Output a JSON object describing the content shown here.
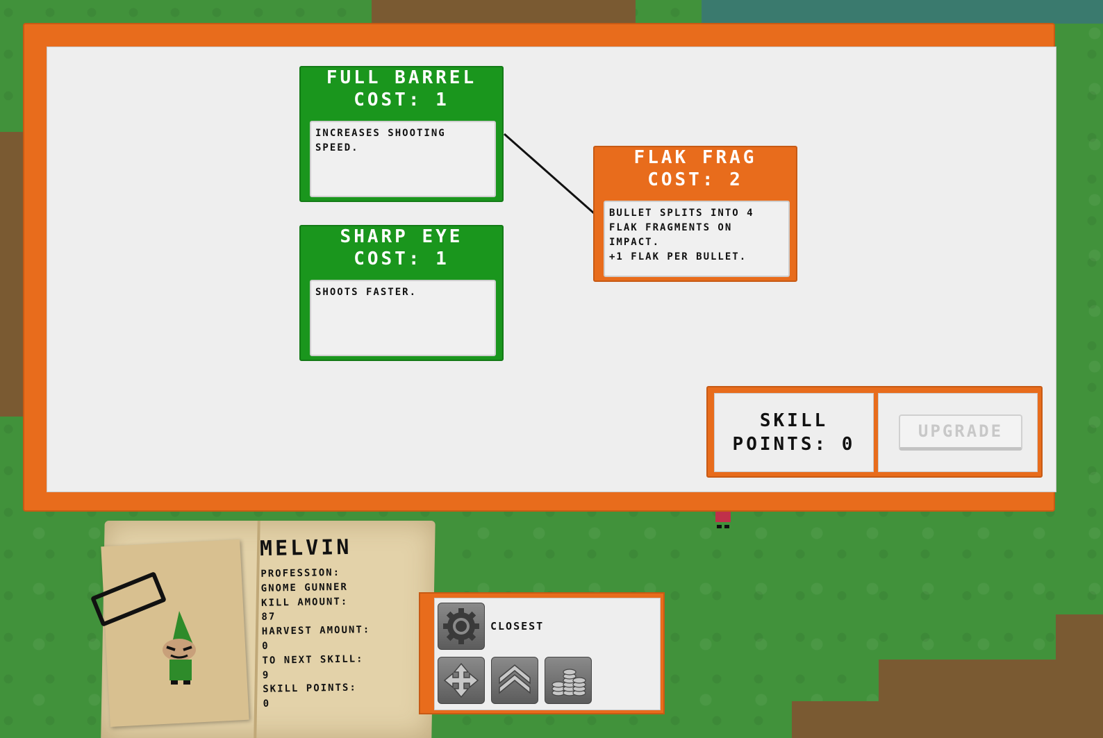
{
  "skill_tree": {
    "nodes": [
      {
        "title": "FULL BARREL",
        "cost": "COST: 1",
        "description": "INCREASES SHOOTING\nSPEED.",
        "state": "purchased",
        "color": "#1a961d"
      },
      {
        "title": "SHARP EYE",
        "cost": "COST: 1",
        "description": "SHOOTS FASTER.",
        "state": "purchased",
        "color": "#1a961d"
      },
      {
        "title": "FLAK FRAG",
        "cost": "COST: 2",
        "description": "BULLET SPLITS INTO 4\nFLAK FRAGMENTS ON\nIMPACT.\n+1 FLAK PER BULLET.",
        "state": "available",
        "color": "#e86c1c"
      }
    ],
    "skill_points_label": "SKILL POINTS: 0",
    "upgrade_label": "UPGRADE",
    "upgrade_enabled": false
  },
  "character": {
    "name": "MELVIN",
    "stats": [
      {
        "label": "PROFESSION:",
        "value": "GNOME GUNNER"
      },
      {
        "label": "KILL AMOUNT:",
        "value": "87"
      },
      {
        "label": "HARVEST AMOUNT:",
        "value": "0"
      },
      {
        "label": "TO NEXT SKILL:",
        "value": "9"
      },
      {
        "label": "SKILL POINTS:",
        "value": "0"
      }
    ]
  },
  "control_panel": {
    "targeting_label": "CLOSEST",
    "icons": [
      "gear-icon",
      "move-icon",
      "upgrade-chevron-icon",
      "coins-icon"
    ]
  },
  "colors": {
    "panel_orange": "#e86c1c",
    "purchased_green": "#1a961d",
    "panel_background": "#eeeeee"
  }
}
